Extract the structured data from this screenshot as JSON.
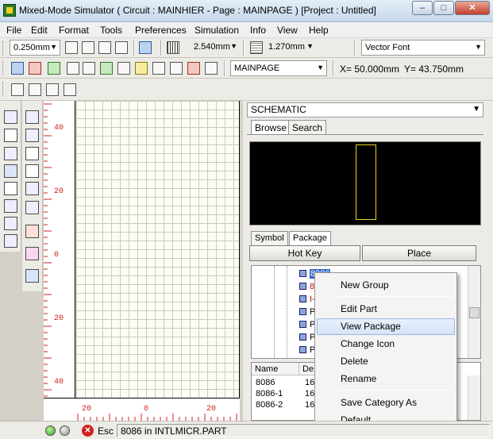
{
  "window": {
    "title": "Mixed-Mode Simulator ( Circuit : MAINHIER - Page : MAINPAGE ) [Project : Untitled]",
    "min_glyph": "–",
    "max_glyph": "□",
    "close_glyph": "✕"
  },
  "menu": [
    "File",
    "Edit",
    "Format",
    "Tools",
    "Preferences",
    "Simulation",
    "Info",
    "View",
    "Help"
  ],
  "toolbar1": {
    "line_width": "0.250mm",
    "grid_size": "2.540mm",
    "snap_size": "1.270mm",
    "font": "Vector Font"
  },
  "toolbar2": {
    "page": "MAINPAGE",
    "coord_x": "X= 50.000mm",
    "coord_y": "Y= 43.750mm"
  },
  "ruler_v_labels": [
    "40",
    "20",
    "0",
    "20",
    "40"
  ],
  "ruler_h_labels": [
    "20",
    "0",
    "20"
  ],
  "panel": {
    "library": "SCHEMATIC",
    "tabs_top": [
      "Browse",
      "Search"
    ],
    "tabs_bottom": [
      "Symbol",
      "Package"
    ],
    "hot_key": "Hot Key",
    "place": "Place"
  },
  "tree": [
    {
      "label": "8086",
      "style": "sel"
    },
    {
      "label": "808",
      "style": "red"
    },
    {
      "label": "I-48",
      "style": "red"
    },
    {
      "label": "P87",
      "style": ""
    },
    {
      "label": "PIC",
      "style": ""
    },
    {
      "label": "PIC",
      "style": ""
    },
    {
      "label": "PIC",
      "style": ""
    }
  ],
  "list": {
    "col_name": "Name",
    "col_desc": "De",
    "rows": [
      {
        "name": "8086",
        "desc": "16"
      },
      {
        "name": "8086-1",
        "desc": "16"
      },
      {
        "name": "8086-2",
        "desc": "16"
      }
    ]
  },
  "context_menu": {
    "items": [
      "New Group",
      "Edit Part",
      "View Package",
      "Change Icon",
      "Delete",
      "Rename",
      "Save Category As",
      "Default"
    ],
    "highlighted": "View Package"
  },
  "status": {
    "esc_label": "Esc",
    "message": "8086 in INTLMICR.PART"
  },
  "colors": {
    "ruler": "#d02020",
    "canvas": "#fdfdf4",
    "preview_bg": "#000000",
    "preview_part": "#e8d020",
    "selection": "#3264c8"
  }
}
